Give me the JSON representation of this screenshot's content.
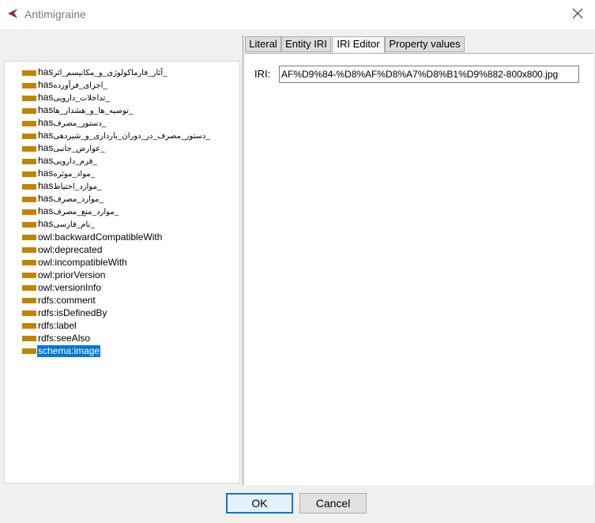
{
  "window": {
    "title": "Antimigraine"
  },
  "toolbar": {
    "icons": [
      "add-sub-property-icon",
      "add-sibling-property-icon",
      "delete-property-icon"
    ]
  },
  "tree": {
    "items": [
      {
        "prefix": "has",
        "rtl": "_آثار_فارماکولوژی_و_مکانیسم_اثر"
      },
      {
        "prefix": "has",
        "rtl": "_اجزای_فرآورده"
      },
      {
        "prefix": "has",
        "rtl": "_تداخلات_دارویی"
      },
      {
        "prefix": "has",
        "rtl": "_توصیه_ها_و_هشدار_ها"
      },
      {
        "prefix": "has",
        "rtl": "_دستور_مصرف"
      },
      {
        "prefix": "has",
        "rtl": "_دستور_مصرف_در_دوران_بارداری_و_شیردهی"
      },
      {
        "prefix": "has",
        "rtl": "_عوارض_جانبی"
      },
      {
        "prefix": "has",
        "rtl": "_فرم_دارویی"
      },
      {
        "prefix": "has",
        "rtl": "_مواد_موثره"
      },
      {
        "prefix": "has",
        "rtl": "_موارد_احتیاط"
      },
      {
        "prefix": "has",
        "rtl": "_موارد_مصرف"
      },
      {
        "prefix": "has",
        "rtl": "_موارد_منع_مصرف"
      },
      {
        "prefix": "has",
        "rtl": "_نام_فارسی"
      },
      {
        "prefix": "owl:backwardCompatibleWith",
        "rtl": ""
      },
      {
        "prefix": "owl:deprecated",
        "rtl": ""
      },
      {
        "prefix": "owl:incompatibleWith",
        "rtl": ""
      },
      {
        "prefix": "owl:priorVersion",
        "rtl": ""
      },
      {
        "prefix": "owl:versionInfo",
        "rtl": ""
      },
      {
        "prefix": "rdfs:comment",
        "rtl": ""
      },
      {
        "prefix": "rdfs:isDefinedBy",
        "rtl": ""
      },
      {
        "prefix": "rdfs:label",
        "rtl": ""
      },
      {
        "prefix": "rdfs:seeAlso",
        "rtl": ""
      },
      {
        "prefix": "schema:image",
        "rtl": "",
        "selected": true
      }
    ]
  },
  "tabs": [
    {
      "label": "Literal"
    },
    {
      "label": "Entity IRI"
    },
    {
      "label": "IRI Editor",
      "active": true
    },
    {
      "label": "Property values"
    }
  ],
  "iri_editor": {
    "label": "IRI:",
    "value": "AF%D9%84-%D8%AF%D8%A7%D8%B1%D9%882-800x800.jpg"
  },
  "buttons": {
    "ok": "OK",
    "cancel": "Cancel"
  },
  "colors": {
    "property_icon": "#c28400",
    "selection": "#0078d7",
    "accent": "#0078d7"
  }
}
